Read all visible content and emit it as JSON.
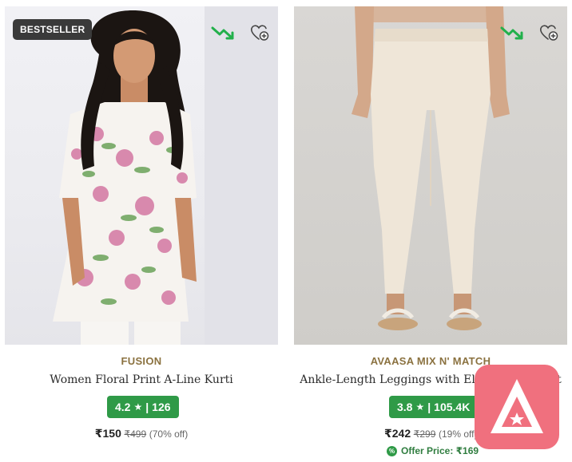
{
  "products": [
    {
      "badge": "BESTSELLER",
      "brand": "FUSION",
      "name": "Women Floral Print A-Line Kurti",
      "rating": "4.2",
      "rating_sep": "|",
      "rating_count": "126",
      "price": "₹150",
      "mrp": "₹499",
      "discount": "(70% off)"
    },
    {
      "brand": "AVAASA MIX N' MATCH",
      "name": "Ankle-Length Leggings with Elasticated Waist",
      "rating": "3.8",
      "rating_sep": "|",
      "rating_count": "105.4K",
      "price": "₹242",
      "mrp": "₹299",
      "discount": "(19% off)",
      "offer_price": "Offer Price: ₹169"
    }
  ],
  "icons": {
    "trend": "trend-down-icon",
    "wishlist": "wishlist-add-icon",
    "star": "★",
    "percent": "%"
  },
  "colors": {
    "badge_bg": "#3a3a3a",
    "brand_text": "#8b7240",
    "rating_bg": "#2f9a47",
    "trend_green": "#22b04b",
    "offer_green": "#2f7d3f",
    "fab_bg": "#f0707e"
  },
  "overlay": {
    "icon": "app-logo-icon"
  }
}
